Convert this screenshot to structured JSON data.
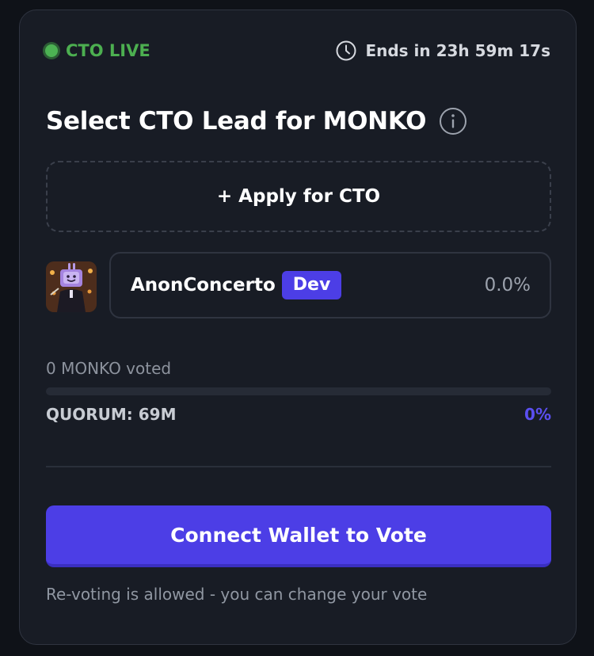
{
  "status": {
    "live_label": "CTO LIVE",
    "ends_label": "Ends in 23h 59m 17s",
    "live_color": "#4caf50"
  },
  "header": {
    "title": "Select CTO Lead for MONKO",
    "info_icon": "info-circle-icon"
  },
  "apply": {
    "label": "+ Apply for CTO"
  },
  "candidates": [
    {
      "name": "AnonConcerto",
      "badge": "Dev",
      "percent": "0.0%",
      "avatar_icon": "avatar-image"
    }
  ],
  "voting": {
    "voted_text": "0 MONKO voted",
    "progress_fraction": 0,
    "quorum_label": "QUORUM: 69M",
    "quorum_percent": "0%"
  },
  "actions": {
    "connect_label": "Connect Wallet to Vote",
    "note": "Re-voting is allowed - you can change your vote"
  },
  "colors": {
    "accent": "#4c3ee6",
    "card_bg": "#181c25",
    "page_bg": "#0f1218"
  }
}
